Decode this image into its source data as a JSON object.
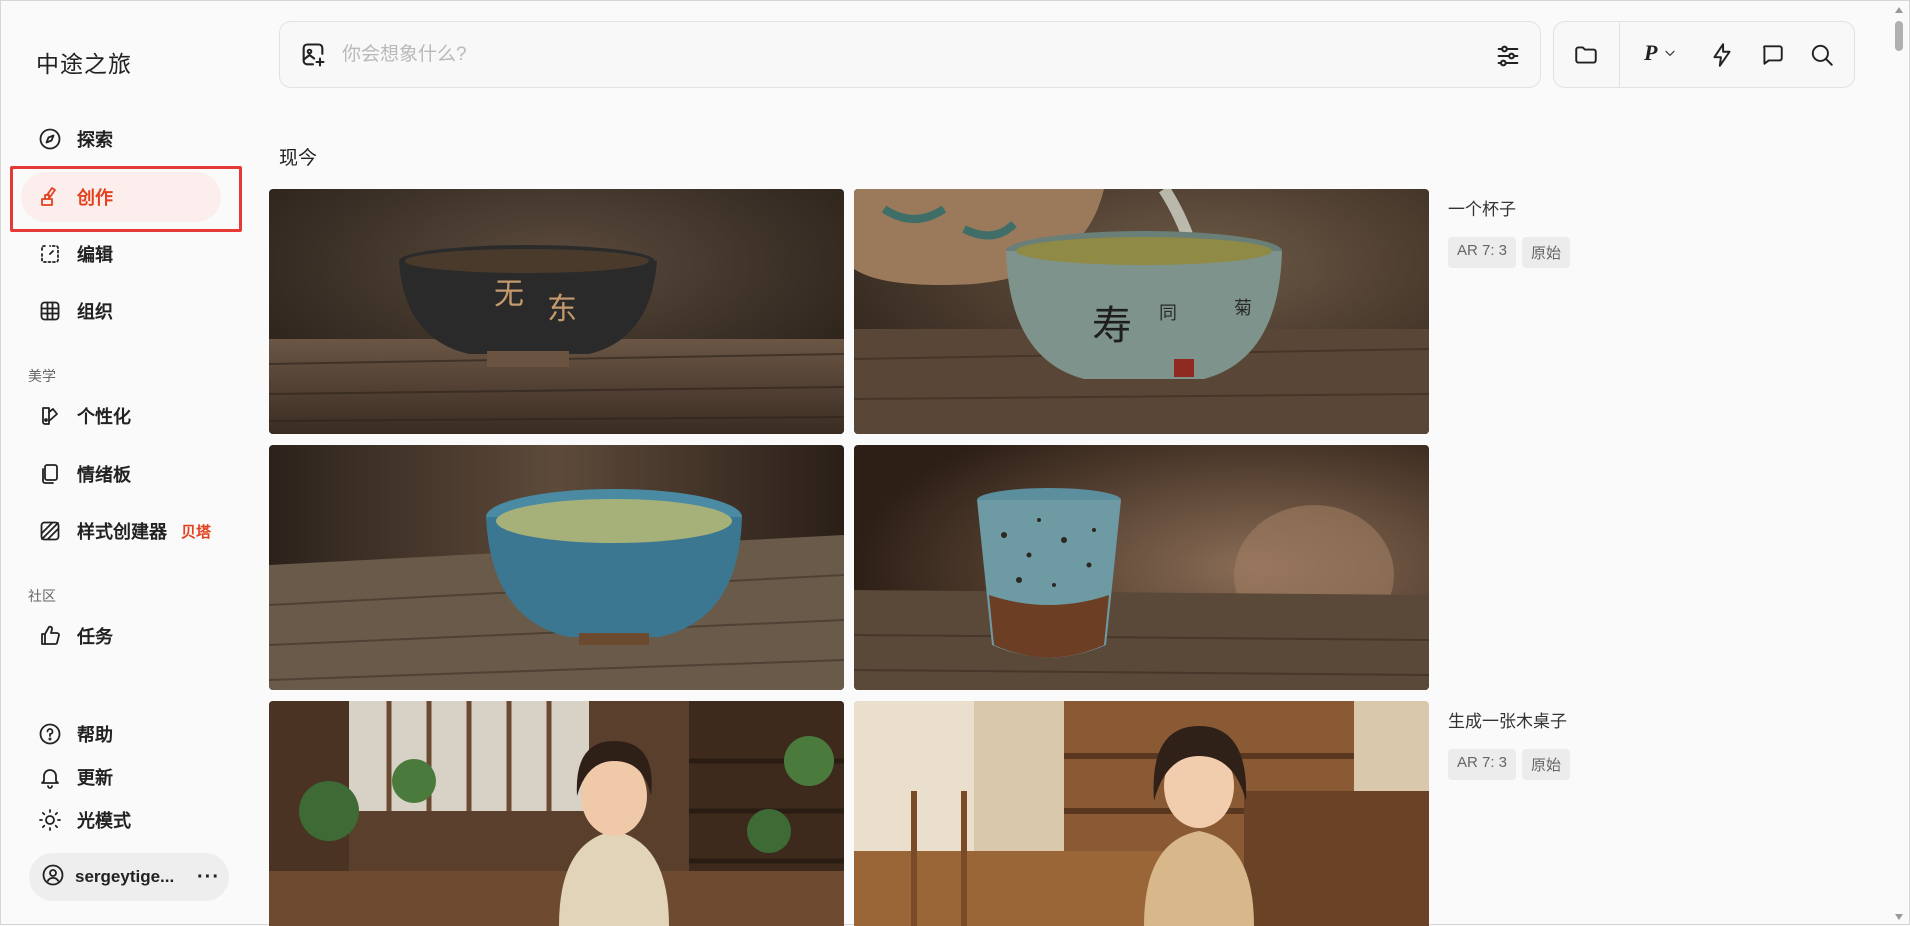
{
  "app": {
    "logo": "中途之旅"
  },
  "sidebar": {
    "items": [
      {
        "label": "探索",
        "icon": "compass-icon"
      },
      {
        "label": "创作",
        "icon": "paintbrush-icon",
        "active": true
      },
      {
        "label": "编辑",
        "icon": "edit-select-icon"
      },
      {
        "label": "组织",
        "icon": "grid-icon"
      }
    ],
    "aesthetics_title": "美学",
    "aesthetics": [
      {
        "label": "个性化",
        "icon": "personalize-icon"
      },
      {
        "label": "情绪板",
        "icon": "moodboard-icon"
      },
      {
        "label": "样式创建器",
        "icon": "style-creator-icon",
        "badge": "贝塔"
      }
    ],
    "community_title": "社区",
    "community": [
      {
        "label": "任务",
        "icon": "thumbs-up-icon"
      }
    ],
    "footer": [
      {
        "label": "帮助",
        "icon": "help-icon"
      },
      {
        "label": "更新",
        "icon": "bell-icon"
      },
      {
        "label": "光模式",
        "icon": "sun-icon"
      }
    ],
    "user": {
      "name": "sergeytige...",
      "menu": "···"
    }
  },
  "search": {
    "placeholder": "你会想象什么?",
    "value": ""
  },
  "toolbar": {
    "personalize_label": "P"
  },
  "main": {
    "section_label": "现今",
    "jobs": [
      {
        "prompt": "一个杯子",
        "tags": [
          "AR 7:  3",
          "原始"
        ]
      },
      {
        "prompt": "生成一张木桌子",
        "tags": [
          "AR 7:  3",
          "原始"
        ]
      }
    ]
  },
  "colors": {
    "accent": "#e2421e",
    "active_bg": "#fdeeee",
    "highlight_outline": "#e53935"
  }
}
